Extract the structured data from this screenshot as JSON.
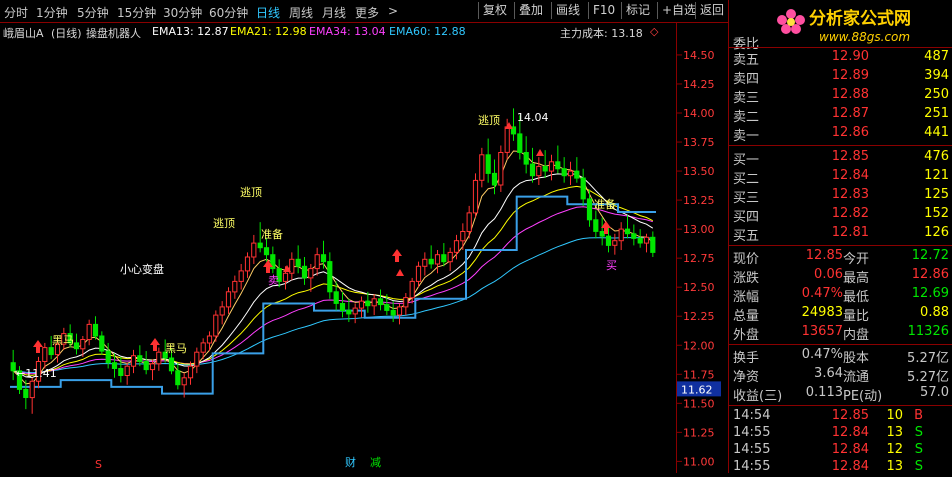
{
  "toolbar": {
    "periods": [
      "分时",
      "1分钟",
      "5分钟",
      "15分钟",
      "30分钟",
      "60分钟",
      "日线",
      "周线",
      "月线",
      "更多"
    ],
    "active_period": "日线",
    "more_arrow": ">",
    "buttons": [
      "复权",
      "叠加",
      "画线",
      "F10",
      "标记",
      "+自选",
      "返回"
    ]
  },
  "info": {
    "stock_name": "峨眉山A",
    "period_tag": "(日线)",
    "indicator": "操盘机器人",
    "ema13": "EMA13: 12.87",
    "ema21": "EMA21: 12.98",
    "ema34": "EMA34: 13.04",
    "ema60": "EMA60: 12.88",
    "cost_label": "主力成本: 13.18",
    "cost_marker": "◇"
  },
  "colors": {
    "up": "#ff3232",
    "down": "#00e600",
    "ema13": "#ffffff",
    "ema21": "#ffff00",
    "ema34": "#ff40ff",
    "ema60": "#30c8ff",
    "cost_line": "#3aa0e8",
    "annot_yellow": "#ffff66",
    "grid": "#8a0000"
  },
  "axis": {
    "y_ticks": [
      "14.50",
      "14.25",
      "14.00",
      "13.75",
      "13.50",
      "13.25",
      "13.00",
      "12.75",
      "12.50",
      "12.25",
      "12.00",
      "11.75",
      "11.50",
      "11.25",
      "11.00"
    ],
    "y_range": [
      10.9,
      14.62
    ],
    "current_price_tag": "11.62"
  },
  "annotations": {
    "high_label": "14.04",
    "low_label": "←11.41",
    "escape_top": "逃顶",
    "prepare": "准备",
    "careful": "小心变盘",
    "dark_horse": "黑马",
    "sell": "卖",
    "buy": "买",
    "bottom_cai": "财",
    "bottom_jian": "减",
    "bottom_s": "S"
  },
  "chart_data": {
    "type": "candlestick",
    "title": "峨眉山A (日线)",
    "candles": [
      [
        11.85,
        11.96,
        11.7,
        11.78
      ],
      [
        11.78,
        11.82,
        11.58,
        11.62
      ],
      [
        11.62,
        11.7,
        11.45,
        11.55
      ],
      [
        11.55,
        11.72,
        11.41,
        11.69
      ],
      [
        11.69,
        11.9,
        11.63,
        11.86
      ],
      [
        11.86,
        12.02,
        11.8,
        11.98
      ],
      [
        11.98,
        12.08,
        11.88,
        11.92
      ],
      [
        11.92,
        12.05,
        11.85,
        12.01
      ],
      [
        12.01,
        12.15,
        11.96,
        12.1
      ],
      [
        12.1,
        12.18,
        11.98,
        12.02
      ],
      [
        12.02,
        12.1,
        11.92,
        11.97
      ],
      [
        11.97,
        12.08,
        11.9,
        12.05
      ],
      [
        12.05,
        12.22,
        12.0,
        12.18
      ],
      [
        12.18,
        12.25,
        12.05,
        12.08
      ],
      [
        12.08,
        12.12,
        11.92,
        11.95
      ],
      [
        11.95,
        12.02,
        11.8,
        11.85
      ],
      [
        11.85,
        11.93,
        11.72,
        11.8
      ],
      [
        11.8,
        11.9,
        11.68,
        11.74
      ],
      [
        11.74,
        11.85,
        11.66,
        11.82
      ],
      [
        11.82,
        11.96,
        11.76,
        11.91
      ],
      [
        11.91,
        12.0,
        11.82,
        11.86
      ],
      [
        11.86,
        11.95,
        11.75,
        11.79
      ],
      [
        11.79,
        11.88,
        11.7,
        11.84
      ],
      [
        11.84,
        11.98,
        11.78,
        11.94
      ],
      [
        11.94,
        12.05,
        11.85,
        11.89
      ],
      [
        11.89,
        11.97,
        11.75,
        11.78
      ],
      [
        11.78,
        11.85,
        11.62,
        11.66
      ],
      [
        11.66,
        11.76,
        11.55,
        11.72
      ],
      [
        11.72,
        11.86,
        11.66,
        11.82
      ],
      [
        11.82,
        11.98,
        11.76,
        11.94
      ],
      [
        11.94,
        12.06,
        11.88,
        12.02
      ],
      [
        12.02,
        12.12,
        11.95,
        12.08
      ],
      [
        12.08,
        12.3,
        12.03,
        12.26
      ],
      [
        12.26,
        12.38,
        12.18,
        12.33
      ],
      [
        12.33,
        12.5,
        12.27,
        12.46
      ],
      [
        12.46,
        12.6,
        12.4,
        12.55
      ],
      [
        12.55,
        12.7,
        12.48,
        12.64
      ],
      [
        12.64,
        12.8,
        12.58,
        12.76
      ],
      [
        12.76,
        12.95,
        12.7,
        12.88
      ],
      [
        12.88,
        13.06,
        12.8,
        12.84
      ],
      [
        12.84,
        12.92,
        12.72,
        12.78
      ],
      [
        12.78,
        12.85,
        12.62,
        12.66
      ],
      [
        12.66,
        12.74,
        12.5,
        12.55
      ],
      [
        12.55,
        12.68,
        12.48,
        12.62
      ],
      [
        12.62,
        12.8,
        12.56,
        12.74
      ],
      [
        12.74,
        12.86,
        12.62,
        12.68
      ],
      [
        12.68,
        12.76,
        12.52,
        12.58
      ],
      [
        12.58,
        12.7,
        12.46,
        12.66
      ],
      [
        12.66,
        12.84,
        12.6,
        12.78
      ],
      [
        12.78,
        12.9,
        12.66,
        12.72
      ],
      [
        12.72,
        12.8,
        12.4,
        12.46
      ],
      [
        12.46,
        12.55,
        12.3,
        12.36
      ],
      [
        12.36,
        12.46,
        12.24,
        12.3
      ],
      [
        12.3,
        12.4,
        12.2,
        12.27
      ],
      [
        12.27,
        12.36,
        12.19,
        12.32
      ],
      [
        12.32,
        12.42,
        12.24,
        12.38
      ],
      [
        12.38,
        12.46,
        12.28,
        12.34
      ],
      [
        12.34,
        12.44,
        12.26,
        12.4
      ],
      [
        12.4,
        12.48,
        12.3,
        12.35
      ],
      [
        12.35,
        12.44,
        12.26,
        12.3
      ],
      [
        12.3,
        12.38,
        12.2,
        12.26
      ],
      [
        12.26,
        12.36,
        12.18,
        12.33
      ],
      [
        12.33,
        12.45,
        12.26,
        12.41
      ],
      [
        12.41,
        12.58,
        12.36,
        12.55
      ],
      [
        12.55,
        12.72,
        12.5,
        12.68
      ],
      [
        12.68,
        12.8,
        12.6,
        12.74
      ],
      [
        12.74,
        12.86,
        12.66,
        12.7
      ],
      [
        12.7,
        12.82,
        12.62,
        12.78
      ],
      [
        12.78,
        12.88,
        12.68,
        12.72
      ],
      [
        12.72,
        12.84,
        12.64,
        12.8
      ],
      [
        12.8,
        12.95,
        12.74,
        12.9
      ],
      [
        12.9,
        13.05,
        12.82,
        12.98
      ],
      [
        12.98,
        13.2,
        12.92,
        13.14
      ],
      [
        13.14,
        13.48,
        13.1,
        13.42
      ],
      [
        13.42,
        13.7,
        13.36,
        13.64
      ],
      [
        13.64,
        13.78,
        13.4,
        13.48
      ],
      [
        13.48,
        13.6,
        13.3,
        13.38
      ],
      [
        13.38,
        13.72,
        13.32,
        13.66
      ],
      [
        13.66,
        13.95,
        13.6,
        13.88
      ],
      [
        13.88,
        14.04,
        13.76,
        13.82
      ],
      [
        13.82,
        13.98,
        13.6,
        13.66
      ],
      [
        13.66,
        13.8,
        13.48,
        13.56
      ],
      [
        13.56,
        13.7,
        13.4,
        13.46
      ],
      [
        13.46,
        13.62,
        13.38,
        13.54
      ],
      [
        13.54,
        13.68,
        13.44,
        13.5
      ],
      [
        13.5,
        13.64,
        13.42,
        13.58
      ],
      [
        13.58,
        13.72,
        13.48,
        13.52
      ],
      [
        13.52,
        13.62,
        13.4,
        13.46
      ],
      [
        13.46,
        13.58,
        13.38,
        13.5
      ],
      [
        13.5,
        13.62,
        13.4,
        13.44
      ],
      [
        13.44,
        13.52,
        13.2,
        13.26
      ],
      [
        13.26,
        13.34,
        13.02,
        13.08
      ],
      [
        13.08,
        13.16,
        12.92,
        12.98
      ],
      [
        12.98,
        13.1,
        12.86,
        12.94
      ],
      [
        12.94,
        13.02,
        12.8,
        12.86
      ],
      [
        12.86,
        12.96,
        12.78,
        12.9
      ],
      [
        12.9,
        13.06,
        12.82,
        13.0
      ],
      [
        13.0,
        13.12,
        12.92,
        12.96
      ],
      [
        12.96,
        13.04,
        12.86,
        12.92
      ],
      [
        12.92,
        13.0,
        12.84,
        12.88
      ],
      [
        12.88,
        12.96,
        12.8,
        12.93
      ],
      [
        12.93,
        12.98,
        12.76,
        12.8
      ]
    ]
  },
  "quote": {
    "header": "委比",
    "ask": [
      {
        "label": "卖五",
        "price": "12.90",
        "vol": "487"
      },
      {
        "label": "卖四",
        "price": "12.89",
        "vol": "394"
      },
      {
        "label": "卖三",
        "price": "12.88",
        "vol": "250"
      },
      {
        "label": "卖二",
        "price": "12.87",
        "vol": "251"
      },
      {
        "label": "卖一",
        "price": "12.86",
        "vol": "441"
      }
    ],
    "bid": [
      {
        "label": "买一",
        "price": "12.85",
        "vol": "476"
      },
      {
        "label": "买二",
        "price": "12.84",
        "vol": "121"
      },
      {
        "label": "买三",
        "price": "12.83",
        "vol": "125"
      },
      {
        "label": "买四",
        "price": "12.82",
        "vol": "152"
      },
      {
        "label": "买五",
        "price": "12.81",
        "vol": "126"
      }
    ],
    "stats": [
      {
        "l1": "现价",
        "v1": "12.85",
        "l2": "今开",
        "v2": "12.72"
      },
      {
        "l1": "涨跌",
        "v1": "0.06",
        "l2": "最高",
        "v2": "12.86"
      },
      {
        "l1": "涨幅",
        "v1": "0.47%",
        "l2": "最低",
        "v2": "12.69"
      },
      {
        "l1": "总量",
        "v1": "24983",
        "l2": "量比",
        "v2": "0.88"
      },
      {
        "l1": "外盘",
        "v1": "13657",
        "l2": "内盘",
        "v2": "11326"
      }
    ],
    "stats2": [
      {
        "l1": "换手",
        "v1": "0.47%",
        "l2": "股本",
        "v2": "5.27亿"
      },
      {
        "l1": "净资",
        "v1": "3.64",
        "l2": "流通",
        "v2": "5.27亿"
      },
      {
        "l1": "收益(三)",
        "v1": "0.113",
        "l2": "PE(动)",
        "v2": "57.0"
      }
    ],
    "ticks": [
      {
        "time": "14:54",
        "price": "12.85",
        "vol": "10",
        "side": "B"
      },
      {
        "time": "14:55",
        "price": "12.84",
        "vol": "13",
        "side": "S"
      },
      {
        "time": "14:55",
        "price": "12.84",
        "vol": "12",
        "side": "S"
      },
      {
        "time": "14:55",
        "price": "12.84",
        "vol": "13",
        "side": "S"
      }
    ]
  },
  "logo": {
    "name": "分析家公式网",
    "url": "www.88gs.com"
  }
}
